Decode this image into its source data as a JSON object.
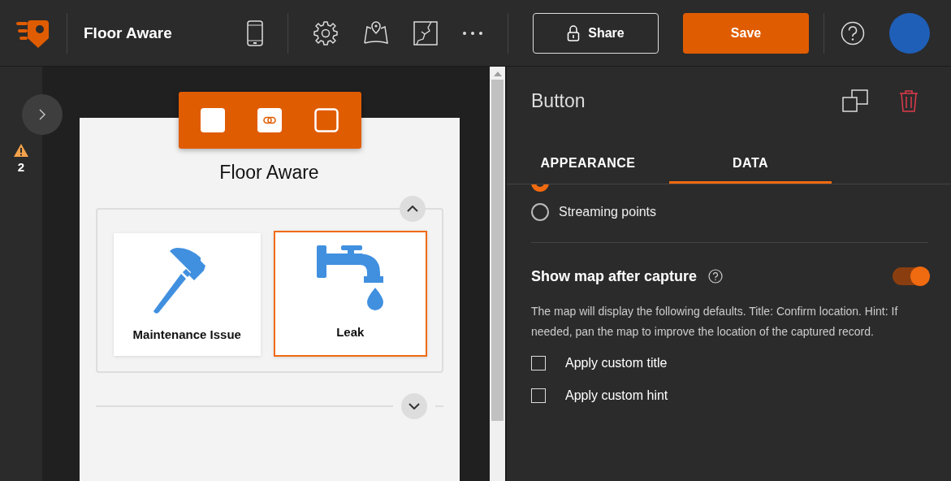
{
  "app": {
    "title": "Floor Aware"
  },
  "toolbar": {
    "share": "Share",
    "save": "Save"
  },
  "sidebar": {
    "warning_count": "2"
  },
  "canvas": {
    "title": "Floor Aware",
    "choices": [
      {
        "label": "Maintenance Issue",
        "kind": "hammer",
        "selected": false
      },
      {
        "label": "Leak",
        "kind": "faucet",
        "selected": true
      }
    ]
  },
  "panel": {
    "title": "Button",
    "tabs": [
      {
        "label": "APPEARANCE",
        "selected": false
      },
      {
        "label": "DATA",
        "selected": true
      }
    ],
    "radios": [
      {
        "selected": true
      },
      {
        "label": "Streaming points",
        "selected": false
      }
    ],
    "setting": {
      "label": "Show map after capture",
      "on": true,
      "description": "The map will display the following defaults. Title: Confirm location. Hint: If needed, pan the map to improve the location of the captured record."
    },
    "checkboxes": [
      {
        "label": "Apply custom title",
        "checked": false
      },
      {
        "label": "Apply custom hint",
        "checked": false
      }
    ]
  }
}
